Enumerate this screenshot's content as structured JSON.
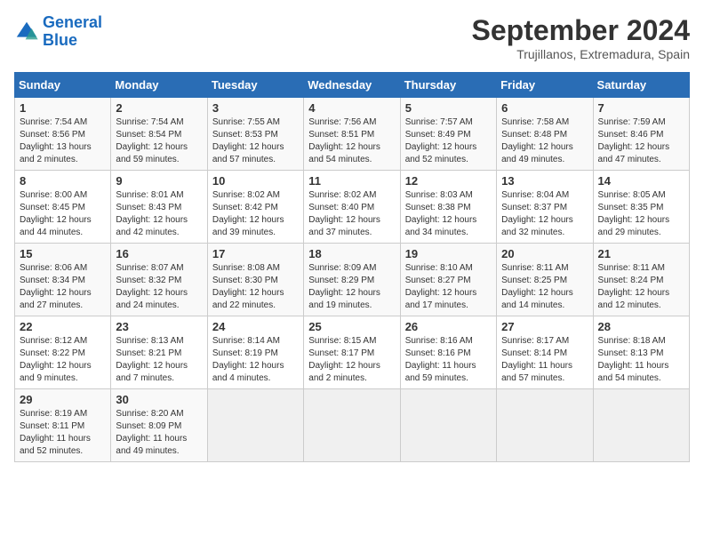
{
  "header": {
    "logo_line1": "General",
    "logo_line2": "Blue",
    "month_title": "September 2024",
    "location": "Trujillanos, Extremadura, Spain"
  },
  "days_of_week": [
    "Sunday",
    "Monday",
    "Tuesday",
    "Wednesday",
    "Thursday",
    "Friday",
    "Saturday"
  ],
  "weeks": [
    [
      {
        "day": 1,
        "sunrise": "7:54 AM",
        "sunset": "8:56 PM",
        "daylight": "13 hours and 2 minutes."
      },
      {
        "day": 2,
        "sunrise": "7:54 AM",
        "sunset": "8:54 PM",
        "daylight": "12 hours and 59 minutes."
      },
      {
        "day": 3,
        "sunrise": "7:55 AM",
        "sunset": "8:53 PM",
        "daylight": "12 hours and 57 minutes."
      },
      {
        "day": 4,
        "sunrise": "7:56 AM",
        "sunset": "8:51 PM",
        "daylight": "12 hours and 54 minutes."
      },
      {
        "day": 5,
        "sunrise": "7:57 AM",
        "sunset": "8:49 PM",
        "daylight": "12 hours and 52 minutes."
      },
      {
        "day": 6,
        "sunrise": "7:58 AM",
        "sunset": "8:48 PM",
        "daylight": "12 hours and 49 minutes."
      },
      {
        "day": 7,
        "sunrise": "7:59 AM",
        "sunset": "8:46 PM",
        "daylight": "12 hours and 47 minutes."
      }
    ],
    [
      {
        "day": 8,
        "sunrise": "8:00 AM",
        "sunset": "8:45 PM",
        "daylight": "12 hours and 44 minutes."
      },
      {
        "day": 9,
        "sunrise": "8:01 AM",
        "sunset": "8:43 PM",
        "daylight": "12 hours and 42 minutes."
      },
      {
        "day": 10,
        "sunrise": "8:02 AM",
        "sunset": "8:42 PM",
        "daylight": "12 hours and 39 minutes."
      },
      {
        "day": 11,
        "sunrise": "8:02 AM",
        "sunset": "8:40 PM",
        "daylight": "12 hours and 37 minutes."
      },
      {
        "day": 12,
        "sunrise": "8:03 AM",
        "sunset": "8:38 PM",
        "daylight": "12 hours and 34 minutes."
      },
      {
        "day": 13,
        "sunrise": "8:04 AM",
        "sunset": "8:37 PM",
        "daylight": "12 hours and 32 minutes."
      },
      {
        "day": 14,
        "sunrise": "8:05 AM",
        "sunset": "8:35 PM",
        "daylight": "12 hours and 29 minutes."
      }
    ],
    [
      {
        "day": 15,
        "sunrise": "8:06 AM",
        "sunset": "8:34 PM",
        "daylight": "12 hours and 27 minutes."
      },
      {
        "day": 16,
        "sunrise": "8:07 AM",
        "sunset": "8:32 PM",
        "daylight": "12 hours and 24 minutes."
      },
      {
        "day": 17,
        "sunrise": "8:08 AM",
        "sunset": "8:30 PM",
        "daylight": "12 hours and 22 minutes."
      },
      {
        "day": 18,
        "sunrise": "8:09 AM",
        "sunset": "8:29 PM",
        "daylight": "12 hours and 19 minutes."
      },
      {
        "day": 19,
        "sunrise": "8:10 AM",
        "sunset": "8:27 PM",
        "daylight": "12 hours and 17 minutes."
      },
      {
        "day": 20,
        "sunrise": "8:11 AM",
        "sunset": "8:25 PM",
        "daylight": "12 hours and 14 minutes."
      },
      {
        "day": 21,
        "sunrise": "8:11 AM",
        "sunset": "8:24 PM",
        "daylight": "12 hours and 12 minutes."
      }
    ],
    [
      {
        "day": 22,
        "sunrise": "8:12 AM",
        "sunset": "8:22 PM",
        "daylight": "12 hours and 9 minutes."
      },
      {
        "day": 23,
        "sunrise": "8:13 AM",
        "sunset": "8:21 PM",
        "daylight": "12 hours and 7 minutes."
      },
      {
        "day": 24,
        "sunrise": "8:14 AM",
        "sunset": "8:19 PM",
        "daylight": "12 hours and 4 minutes."
      },
      {
        "day": 25,
        "sunrise": "8:15 AM",
        "sunset": "8:17 PM",
        "daylight": "12 hours and 2 minutes."
      },
      {
        "day": 26,
        "sunrise": "8:16 AM",
        "sunset": "8:16 PM",
        "daylight": "11 hours and 59 minutes."
      },
      {
        "day": 27,
        "sunrise": "8:17 AM",
        "sunset": "8:14 PM",
        "daylight": "11 hours and 57 minutes."
      },
      {
        "day": 28,
        "sunrise": "8:18 AM",
        "sunset": "8:13 PM",
        "daylight": "11 hours and 54 minutes."
      }
    ],
    [
      {
        "day": 29,
        "sunrise": "8:19 AM",
        "sunset": "8:11 PM",
        "daylight": "11 hours and 52 minutes."
      },
      {
        "day": 30,
        "sunrise": "8:20 AM",
        "sunset": "8:09 PM",
        "daylight": "11 hours and 49 minutes."
      },
      null,
      null,
      null,
      null,
      null
    ]
  ]
}
